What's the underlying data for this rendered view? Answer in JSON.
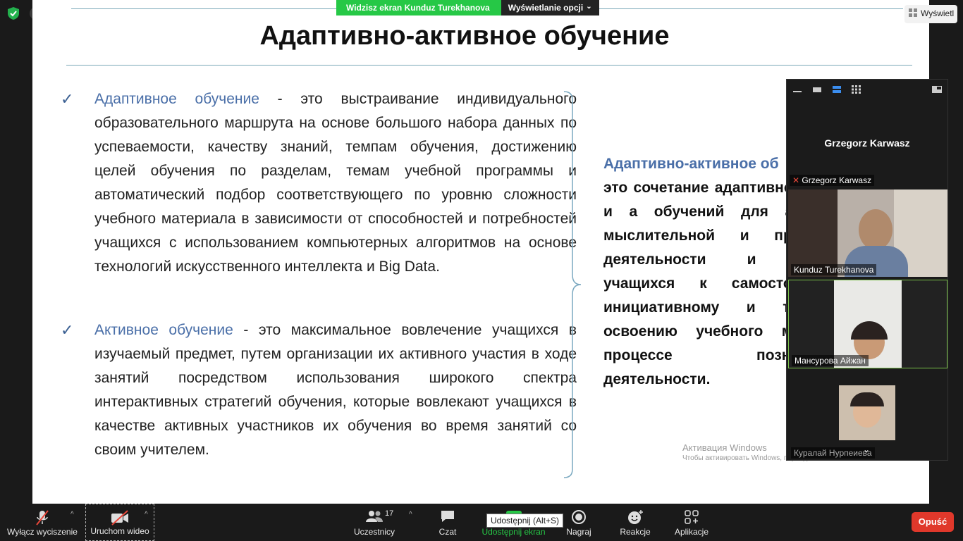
{
  "top": {
    "share_banner": "Widzisz ekran Kunduz Turekhanova",
    "view_options": "Wyświetlanie opcji",
    "view_button": "Wyświetl"
  },
  "slide": {
    "title": "Адаптивно-активное обучение",
    "bullet1": {
      "term": "Адаптивное обучение",
      "text": " - это выстраивание индивидуального образовательного маршрута на основе большого набора данных по успеваемости, качеству знаний, темпам обучения, достижению целей обучения по разделам, темам учебной программы и автоматический подбор соответствующего по уровню сложности учебного материала в зависимости от способностей и потребностей учащихся с использованием компьютерных алгоритмов на основе технологий искусственного интеллекта и Big Data."
    },
    "bullet2": {
      "term": "Активное обучение",
      "text": " - это максимальное вовлечение учащихся в изучаемый предмет, путем организации их активного участия в ходе занятий посредством использования широкого спектра интерактивных стратегий обучения, которые вовлекают учащихся в качестве активных участников их обучения во время занятий со своим учителем."
    },
    "right": {
      "term": "Адаптивно-активное об",
      "text": "это сочетание адаптивного и а обучений для акт мыслительной и прак деятельности и м учащихся к самостоят инициативному и тво освоению учебного мат процессе познав деятельности."
    }
  },
  "watermark": {
    "line1": "Активация Windows",
    "line2": "Чтобы активировать Windows, перейдите"
  },
  "video_panel": {
    "big_name": "Grzegorz Karwasz",
    "tiles": [
      {
        "name": "Grzegorz Karwasz"
      },
      {
        "name": "Kunduz Turekhanova"
      },
      {
        "name": "Мансурова Айжан"
      },
      {
        "name": "Куралай Нурпеиева"
      }
    ]
  },
  "toolbar": {
    "mute": "Wyłącz wyciszenie",
    "video": "Uruchom wideo",
    "participants": "Uczestnicy",
    "participants_count": "17",
    "chat": "Czat",
    "share": "Udostępnij ekran",
    "record": "Nagraj",
    "reactions": "Reakcje",
    "apps": "Aplikacje",
    "tooltip": "Udostępnij (Alt+S)",
    "end": "Opuść"
  },
  "colors": {
    "accent_term": "#4a6fa8",
    "share_green": "#26c846",
    "end_red": "#e0382b"
  }
}
